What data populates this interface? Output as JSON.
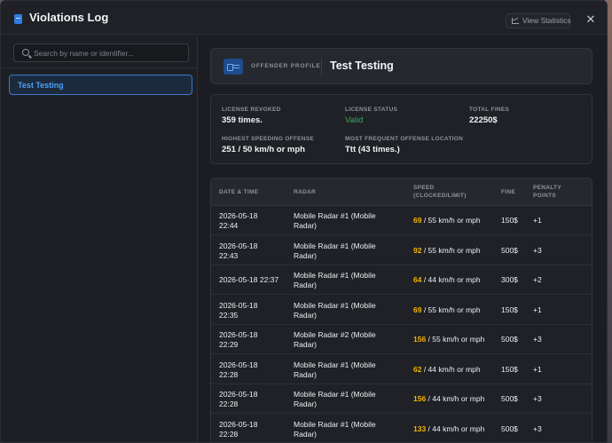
{
  "window": {
    "title": "Violations Log",
    "stats_button": "View Statistics",
    "close_glyph": "✕"
  },
  "sidebar": {
    "search_placeholder": "Search by name or identifier...",
    "items": [
      {
        "label": "Test Testing",
        "selected": true
      }
    ]
  },
  "profile": {
    "label": "OFFENDER PROFILE:",
    "name": "Test Testing"
  },
  "stats": {
    "license_revoked_label": "LICENSE REVOKED",
    "license_revoked_value": "359 times.",
    "license_status_label": "LICENSE STATUS",
    "license_status_value": "Valid",
    "total_fines_label": "TOTAL FINES",
    "total_fines_value": "22250$",
    "highest_speeding_label": "HIGHEST SPEEDING OFFENSE",
    "highest_speeding_value": "251 / 50 km/h or mph",
    "frequent_location_label": "MOST FREQUENT OFFENSE LOCATION",
    "frequent_location_value": "Ttt (43 times.)"
  },
  "table": {
    "headers": {
      "datetime": "DATE & TIME",
      "radar": "RADAR",
      "speed_line1": "SPEED",
      "speed_line2": "(CLOCKED/LIMIT)",
      "fine": "FINE",
      "points_line1": "PENALTY",
      "points_line2": "POINTS"
    },
    "rows": [
      {
        "date": "2026-05-18",
        "time": "22:44",
        "radar1": "Mobile Radar #1 (Mobile",
        "radar2": "Radar)",
        "clocked": "69",
        "limit": " / 55 km/h or mph",
        "fine": "150$",
        "points": "+1"
      },
      {
        "date": "2026-05-18",
        "time": "22:43",
        "radar1": "Mobile Radar #1 (Mobile",
        "radar2": "Radar)",
        "clocked": "92",
        "limit": " / 55 km/h or mph",
        "fine": "500$",
        "points": "+3"
      },
      {
        "date": "2026-05-18 22:37",
        "time": "",
        "radar1": "Mobile Radar #1 (Mobile",
        "radar2": "Radar)",
        "clocked": "64",
        "limit": " / 44 km/h or mph",
        "fine": "300$",
        "points": "+2"
      },
      {
        "date": "2026-05-18",
        "time": "22:35",
        "radar1": "Mobile Radar #1 (Mobile",
        "radar2": "Radar)",
        "clocked": "69",
        "limit": " / 55 km/h or mph",
        "fine": "150$",
        "points": "+1"
      },
      {
        "date": "2026-05-18",
        "time": "22:29",
        "radar1": "Mobile Radar #2 (Mobile",
        "radar2": "Radar)",
        "clocked": "156",
        "limit": " / 55 km/h or mph",
        "fine": "500$",
        "points": "+3"
      },
      {
        "date": "2026-05-18",
        "time": "22:28",
        "radar1": "Mobile Radar #1 (Mobile",
        "radar2": "Radar)",
        "clocked": "62",
        "limit": " / 44 km/h or mph",
        "fine": "150$",
        "points": "+1"
      },
      {
        "date": "2026-05-18",
        "time": "22:28",
        "radar1": "Mobile Radar #1 (Mobile",
        "radar2": "Radar)",
        "clocked": "156",
        "limit": " / 44 km/h or mph",
        "fine": "500$",
        "points": "+3"
      },
      {
        "date": "2026-05-18",
        "time": "22:28",
        "radar1": "Mobile Radar #1 (Mobile",
        "radar2": "Radar)",
        "clocked": "133",
        "limit": " / 44 km/h or mph",
        "fine": "500$",
        "points": "+3"
      }
    ]
  },
  "colors": {
    "accent": "#2f7de1",
    "speed_highlight": "#f5b301",
    "status_valid": "#3aa75d"
  }
}
